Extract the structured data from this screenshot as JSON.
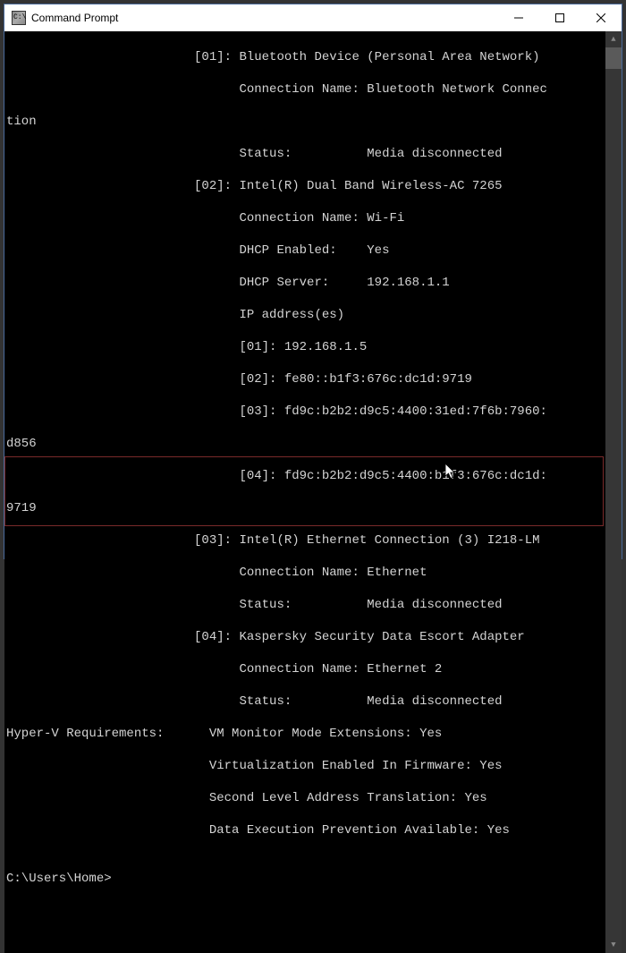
{
  "window": {
    "title": "Command Prompt"
  },
  "lines": {
    "l0": "                         [01]: Bluetooth Device (Personal Area Network)",
    "l1": "                               Connection Name: Bluetooth Network Connec",
    "l2": "tion",
    "l3": "                               Status:          Media disconnected",
    "l4": "                         [02]: Intel(R) Dual Band Wireless-AC 7265",
    "l5": "                               Connection Name: Wi-Fi",
    "l6": "                               DHCP Enabled:    Yes",
    "l7": "                               DHCP Server:     192.168.1.1",
    "l8": "                               IP address(es)",
    "l9": "                               [01]: 192.168.1.5",
    "l10": "                               [02]: fe80::b1f3:676c:dc1d:9719",
    "l11": "                               [03]: fd9c:b2b2:d9c5:4400:31ed:7f6b:7960:",
    "l12": "d856",
    "l13": "                               [04]: fd9c:b2b2:d9c5:4400:b1f3:676c:dc1d:",
    "l14": "9719",
    "l15": "                         [03]: Intel(R) Ethernet Connection (3) I218-LM",
    "l16": "                               Connection Name: Ethernet",
    "l17": "                               Status:          Media disconnected",
    "l18": "                         [04]: Kaspersky Security Data Escort Adapter",
    "l19": "                               Connection Name: Ethernet 2",
    "l20": "                               Status:          Media disconnected",
    "l21": "Hyper-V Requirements:      VM Monitor Mode Extensions: Yes",
    "l22": "                           Virtualization Enabled In Firmware: Yes",
    "l23": "                           Second Level Address Translation: Yes",
    "l24": "                           Data Execution Prevention Available: Yes",
    "l25": "",
    "l26": "C:\\Users\\Home>"
  }
}
